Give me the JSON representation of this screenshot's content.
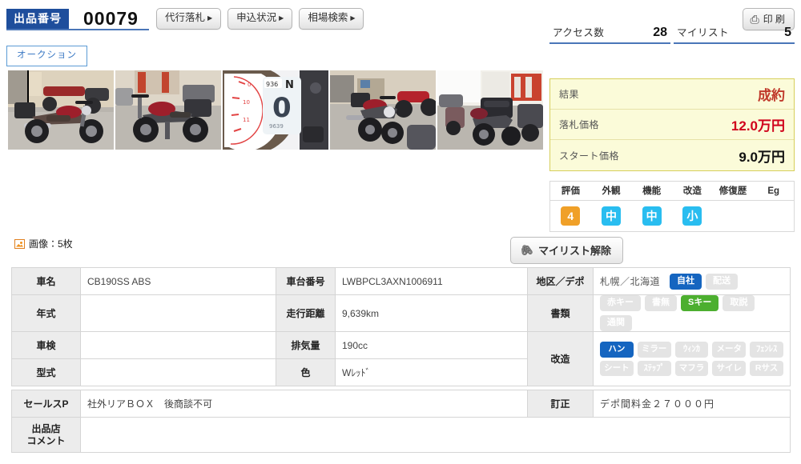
{
  "header": {
    "lot_label": "出品番号",
    "lot_number": "00079",
    "buttons": [
      {
        "label": "代行落札",
        "name": "proxy-bid-button"
      },
      {
        "label": "申込状況",
        "name": "application-status-button"
      },
      {
        "label": "相場検索",
        "name": "market-search-button"
      }
    ],
    "tab_auction": "オークション",
    "print_label": "印 刷",
    "print_icon": "printer-icon"
  },
  "counters": [
    {
      "label": "アクセス数",
      "value": "28",
      "name": "access-count"
    },
    {
      "label": "マイリスト",
      "value": "5",
      "name": "mylist-count"
    }
  ],
  "images": {
    "count_label": "画像：5枚",
    "icon": "image-icon",
    "thumbnails": [
      {
        "alt": "motorcycle-side-left-view"
      },
      {
        "alt": "motorcycle-rear-three-quarter"
      },
      {
        "alt": "instrument-cluster-odometer"
      },
      {
        "alt": "motorcycle-front-three-quarter"
      },
      {
        "alt": "motorcycle-rear-with-top-box"
      }
    ]
  },
  "result": {
    "rows": [
      {
        "label": "結果",
        "value": "成約",
        "style": "r-result",
        "name": "result-status"
      },
      {
        "label": "落札価格",
        "value": "12.0万円",
        "style": "r-bid",
        "name": "winning-price"
      },
      {
        "label": "スタート価格",
        "value": "9.0万円",
        "style": "r-start",
        "name": "start-price"
      }
    ]
  },
  "evaluation": {
    "headers": [
      "評価",
      "外観",
      "機能",
      "改造",
      "修復歴",
      "Eg"
    ],
    "values": [
      {
        "text": "4",
        "color": "orange"
      },
      {
        "text": "中",
        "color": "cyan"
      },
      {
        "text": "中",
        "color": "cyan"
      },
      {
        "text": "小",
        "color": "cyan"
      },
      {
        "text": "",
        "color": "none"
      },
      {
        "text": "",
        "color": "none"
      }
    ]
  },
  "mylist_button": {
    "label": "マイリスト解除",
    "icon": "paperclip-icon"
  },
  "spec_table": {
    "rows": [
      {
        "left_label": "車名",
        "left_value": "CB190SS ABS",
        "mid_label": "車台番号",
        "mid_value": "LWBPCL3AXN1006911"
      },
      {
        "left_label": "年式",
        "left_value": "",
        "mid_label": "走行距離",
        "mid_value": "9,639km"
      },
      {
        "left_label": "車検",
        "left_value": "",
        "mid_label": "排気量",
        "mid_value": "190cc"
      },
      {
        "left_label": "型式",
        "left_value": "",
        "mid_label": "色",
        "mid_value": "Wﾚｯﾄﾞ"
      }
    ],
    "region": {
      "label": "地区／デポ",
      "text": "札幌／北海道",
      "pills": [
        {
          "text": "自社",
          "state": "on-blue"
        },
        {
          "text": "配送",
          "state": "off"
        }
      ]
    },
    "documents": {
      "label": "書類",
      "pills": [
        {
          "text": "赤キー",
          "state": "off"
        },
        {
          "text": "書無",
          "state": "off"
        },
        {
          "text": "Sキー",
          "state": "on-green"
        },
        {
          "text": "取説",
          "state": "off"
        },
        {
          "text": "通関",
          "state": "off"
        }
      ]
    },
    "modifications": {
      "label": "改造",
      "row1": [
        {
          "text": "ハン",
          "state": "on-blue"
        },
        {
          "text": "ミラー",
          "state": "off"
        },
        {
          "text": "ｳｨﾝｶ",
          "state": "off"
        },
        {
          "text": "メータ",
          "state": "off"
        },
        {
          "text": "ﾌｪﾝﾚｽ",
          "state": "off"
        }
      ],
      "row2": [
        {
          "text": "シート",
          "state": "off"
        },
        {
          "text": "ｽﾃｯﾌﾟ",
          "state": "off"
        },
        {
          "text": "マフラ",
          "state": "off"
        },
        {
          "text": "サイレ",
          "state": "off"
        },
        {
          "text": "Rサス",
          "state": "off"
        }
      ]
    },
    "sales_point": {
      "label": "セールスP",
      "value": "社外リアＢＯＸ　後商談不可"
    },
    "correction": {
      "label": "訂正",
      "value": "デポ間料金２７０００円"
    },
    "shop_comment": {
      "label_line1": "出品店",
      "label_line2": "コメント",
      "value": ""
    }
  },
  "colors": {
    "brand_blue": "#1e4e9c",
    "accent_blue": "#1565c0",
    "green": "#4caf2f",
    "orange": "#f0a028",
    "cyan": "#29bdf0",
    "result_red": "#c0392b",
    "price_red": "#d0021b",
    "panel_yellow": "#fbfbd9"
  }
}
